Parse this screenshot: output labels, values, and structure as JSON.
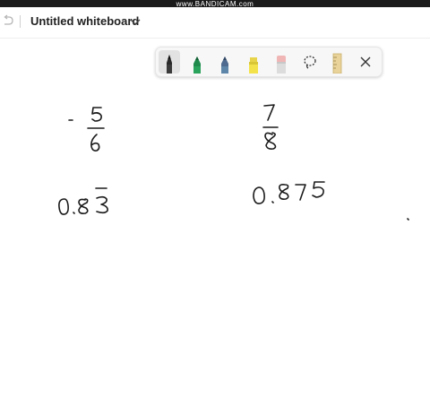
{
  "watermark": "www.BANDICAM.com",
  "header": {
    "title": "Untitled whiteboard"
  },
  "toolbar": {
    "tools": [
      {
        "icon": "black-pen-icon",
        "color": "#1a1a1a",
        "selected": true
      },
      {
        "icon": "green-pen-icon",
        "color": "#1f8a4c",
        "selected": false
      },
      {
        "icon": "blue-pen-icon",
        "color": "#4f6b8f",
        "selected": false
      },
      {
        "icon": "highlighter-icon",
        "color": "#f3e24a",
        "selected": false
      },
      {
        "icon": "eraser-icon",
        "color": "#f0b6b6",
        "selected": false
      },
      {
        "icon": "lasso-icon",
        "selected": false
      },
      {
        "icon": "ruler-icon",
        "color": "#e9d39a",
        "selected": false
      },
      {
        "icon": "close-icon",
        "selected": false
      }
    ]
  },
  "canvas": {
    "ink_color": "#1a1a1a"
  }
}
